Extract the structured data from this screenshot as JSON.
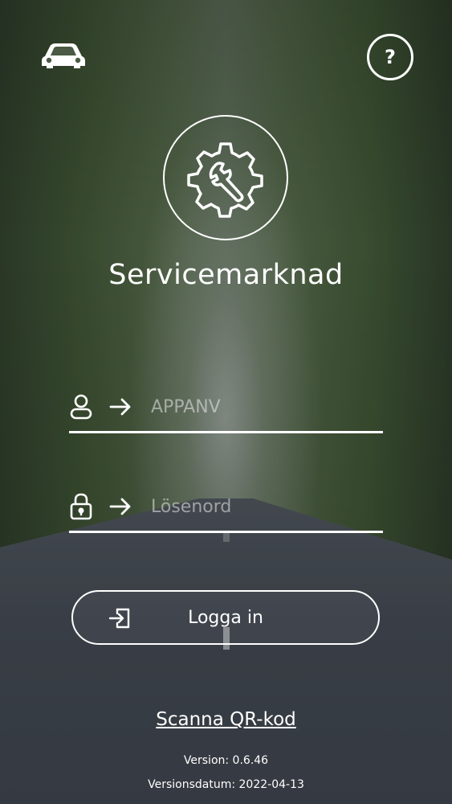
{
  "app": {
    "title": "Servicemarknad"
  },
  "header": {
    "left_icon": "car-icon",
    "right_icon": "help-icon",
    "help_glyph": "?"
  },
  "logo": {
    "icon": "gear-wrench-icon"
  },
  "login": {
    "username": {
      "value": "",
      "placeholder": "APPANV",
      "icon": "user-icon"
    },
    "password": {
      "value": "",
      "placeholder": "Lösenord",
      "icon": "lock-icon"
    },
    "submit_label": "Logga in",
    "submit_icon": "sign-in-icon"
  },
  "qr_link": "Scanna QR-kod",
  "version": "Version: 0.6.46",
  "version_date": "Versionsdatum: 2022-04-13",
  "colors": {
    "foreground": "#ffffff",
    "forest": "#3e5232",
    "road": "#40454e"
  }
}
